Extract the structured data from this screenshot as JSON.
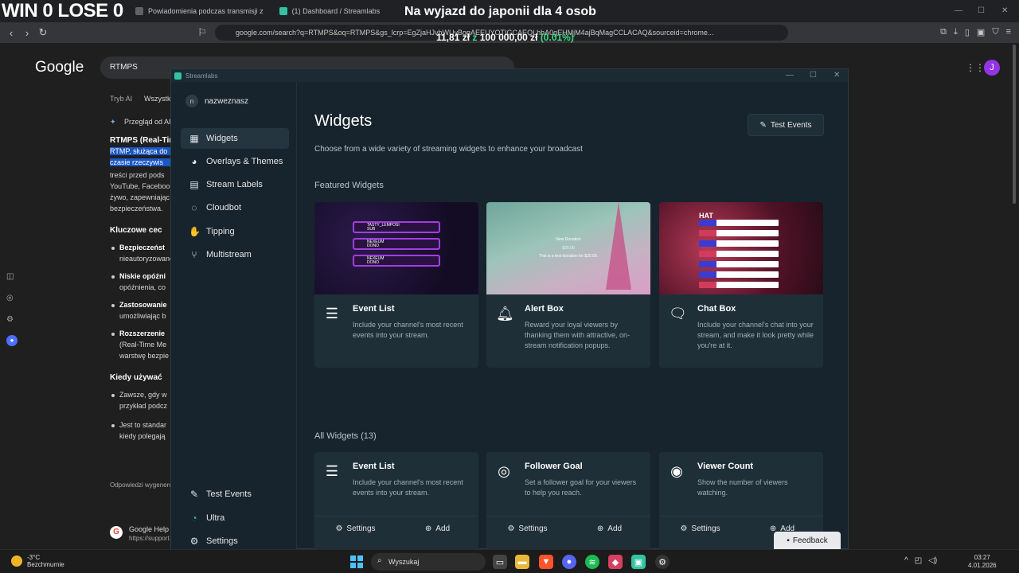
{
  "overlay": {
    "score_text": "WIN 0 LOSE 0",
    "goal_title": "Na wyjazd do japonii dla 4 osob",
    "goal_progress_amount": "11,81 zł",
    "goal_progress_sep": "z",
    "goal_progress_target": "100 000,00 zł",
    "goal_progress_pct": "(0.01%)"
  },
  "browser": {
    "tabs": [
      {
        "label": "Powiadomienia podczas transmisji z"
      },
      {
        "label": "(1) Dashboard / Streamlabs"
      }
    ],
    "url": "google.com/search?q=RTMPS&oq=RTMPS&gs_lcrp=EgZjaHJvbWUyBggAEEUYOTIGCAEQLhhA0gEHMjM4ajBqMagCCLACAQ&sourceid=chrome..."
  },
  "google": {
    "logo": "Google",
    "search_value": "RTMPS",
    "avatar_letter": "J",
    "tab_ai": "Tryb AI",
    "tab_all": "Wszystk",
    "overview_label": "Przegląd od AI",
    "p1": "RTMPS (Real-Tim",
    "p2": "RTMP, służąca do",
    "p3": "czasie rzeczywis",
    "p4": "treści przed pods",
    "p5": "YouTube, Faceboo",
    "p6": "żywo, zapewniając",
    "p7": "bezpieczeństwa.",
    "h_key": "Kluczowe cec",
    "b1a": "Bezpieczeńst",
    "b1b": "nieautoryzowane",
    "b2a": "Niskie opóźni",
    "b2b": "opóźnienia, co",
    "b3a": "Zastosowanie",
    "b3b": "umożliwiając b",
    "b4a": "Rozszerzenie",
    "b4b": "(Real-Time Me",
    "b4c": "warstwę bezpie",
    "h_when": "Kiedy używać",
    "w1a": "Zawsze, gdy w",
    "w1b": "przykład podcz",
    "w2a": "Jest to standar",
    "w2b": "kiedy polegają",
    "foot": "Odpowiedzi wygenero",
    "help_title": "Google Help",
    "help_url": "https://support.g"
  },
  "streamlabs": {
    "window_title": "Streamlabs",
    "account_initial": "n",
    "account_name": "nazweznasz",
    "nav": [
      {
        "label": "Widgets",
        "icon": "grid-icon"
      },
      {
        "label": "Overlays & Themes",
        "icon": "palette-icon"
      },
      {
        "label": "Stream Labels",
        "icon": "document-icon"
      },
      {
        "label": "Cloudbot",
        "icon": "bot-icon"
      },
      {
        "label": "Tipping",
        "icon": "tipping-icon"
      },
      {
        "label": "Multistream",
        "icon": "multistream-icon"
      }
    ],
    "nav_bottom": [
      {
        "label": "Test Events",
        "icon": "wrench-icon"
      },
      {
        "label": "Ultra",
        "icon": "ultra-icon"
      },
      {
        "label": "Settings",
        "icon": "gear-icon"
      }
    ],
    "page_title": "Widgets",
    "page_subtitle": "Choose from a wide variety of streaming widgets to enhance your broadcast",
    "test_events_button": "Test Events",
    "featured_heading": "Featured Widgets",
    "all_heading": "All Widgets (13)",
    "settings_label": "Settings",
    "add_label": "Add",
    "featured": [
      {
        "title": "Event List",
        "desc": "Include your channel's most recent events into your stream.",
        "icon": "list-icon"
      },
      {
        "title": "Alert Box",
        "desc": "Reward your loyal viewers by thanking them with attractive, on-stream notification popups.",
        "icon": "bell-icon"
      },
      {
        "title": "Chat Box",
        "desc": "Include your channel's chat into your stream, and make it look pretty while you're at it.",
        "icon": "chat-icon"
      }
    ],
    "all": [
      {
        "title": "Event List",
        "desc": "Include your channel's most recent events into your stream.",
        "icon": "list-icon"
      },
      {
        "title": "Follower Goal",
        "desc": "Set a follower goal for your viewers to help you reach.",
        "icon": "goal-icon"
      },
      {
        "title": "Viewer Count",
        "desc": "Show the number of viewers watching.",
        "icon": "eye-icon"
      }
    ],
    "thumb_event_rows": [
      {
        "name": "TASTY_LEMPOSI",
        "type": "SUB"
      },
      {
        "name": "NEXEUM",
        "type": "DONO"
      },
      {
        "name": "NEXEUM",
        "type": "DONO"
      }
    ],
    "thumb_alert_title": "New Donation",
    "thumb_alert_amount": "$20.00",
    "thumb_alert_msg": "This is a test donation for $20.00.",
    "thumb_chat_label": "HAT"
  },
  "feedback_button": "Feedback",
  "taskbar": {
    "temp": "-3°C",
    "weather": "Bezchmurnie",
    "search_label": "Wyszukaj",
    "time": "03:27",
    "date": "4.01.2026"
  }
}
